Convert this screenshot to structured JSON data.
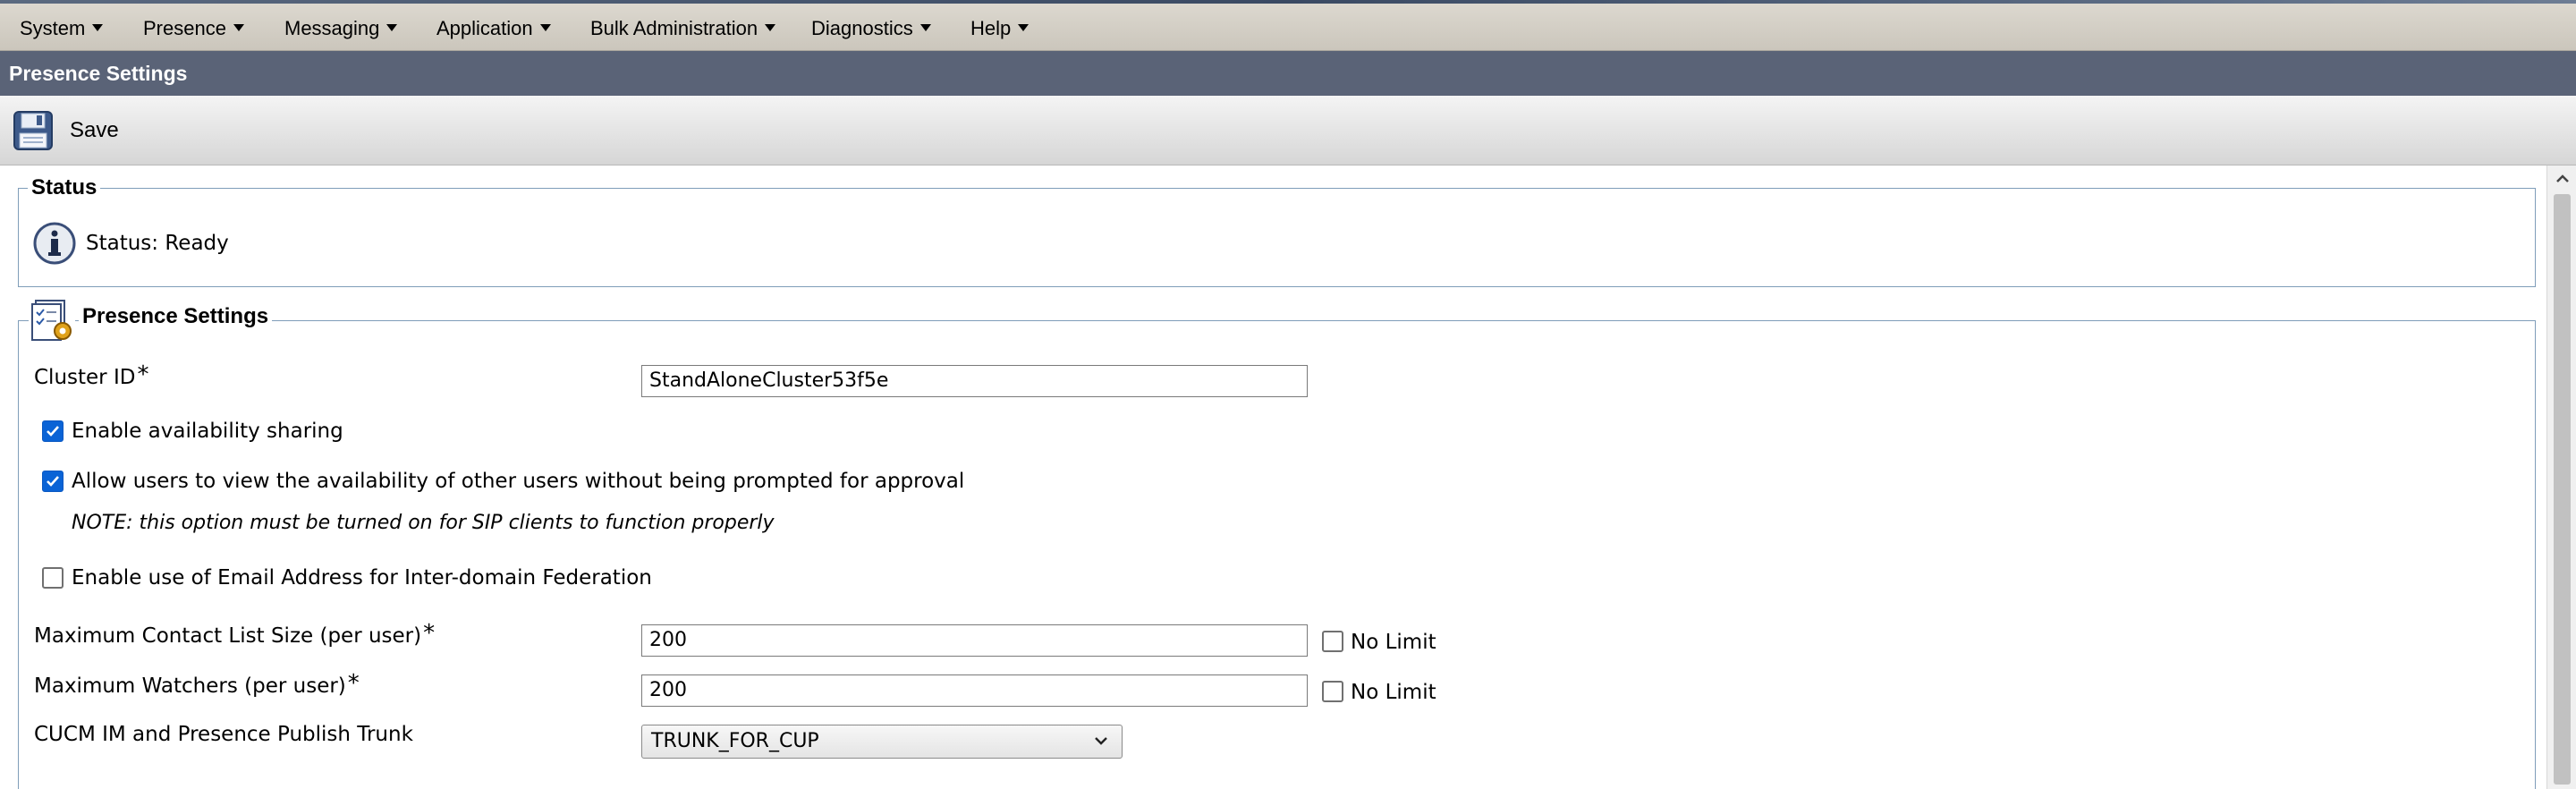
{
  "menu": [
    {
      "label": "System"
    },
    {
      "label": "Presence"
    },
    {
      "label": "Messaging"
    },
    {
      "label": "Application"
    },
    {
      "label": "Bulk Administration"
    },
    {
      "label": "Diagnostics"
    },
    {
      "label": "Help"
    }
  ],
  "page": {
    "title": "Presence Settings"
  },
  "toolbar": {
    "save_label": "Save"
  },
  "status_section": {
    "legend": "Status",
    "text": "Status: Ready"
  },
  "settings": {
    "legend": "Presence Settings",
    "cluster_id": {
      "label": "Cluster ID",
      "required_mark": "*",
      "value": "StandAloneCluster53f5e"
    },
    "availability_sharing": {
      "label": "Enable availability sharing",
      "checked": true
    },
    "allow_view": {
      "label": "Allow users to view the availability of other users without being prompted for approval",
      "checked": true
    },
    "note": "NOTE: this option must be turned on for SIP clients to function properly",
    "email_federation": {
      "label": "Enable use of Email Address for Inter-domain Federation",
      "checked": false
    },
    "max_contact": {
      "label": "Maximum Contact List Size (per user)",
      "required_mark": "*",
      "value": "200",
      "no_limit_label": "No Limit",
      "no_limit_checked": false
    },
    "max_watchers": {
      "label": "Maximum Watchers (per user)",
      "required_mark": "*",
      "value": "200",
      "no_limit_label": "No Limit",
      "no_limit_checked": false
    },
    "publish_trunk": {
      "label": "CUCM IM and Presence Publish Trunk",
      "selected": "TRUNK_FOR_CUP"
    }
  }
}
